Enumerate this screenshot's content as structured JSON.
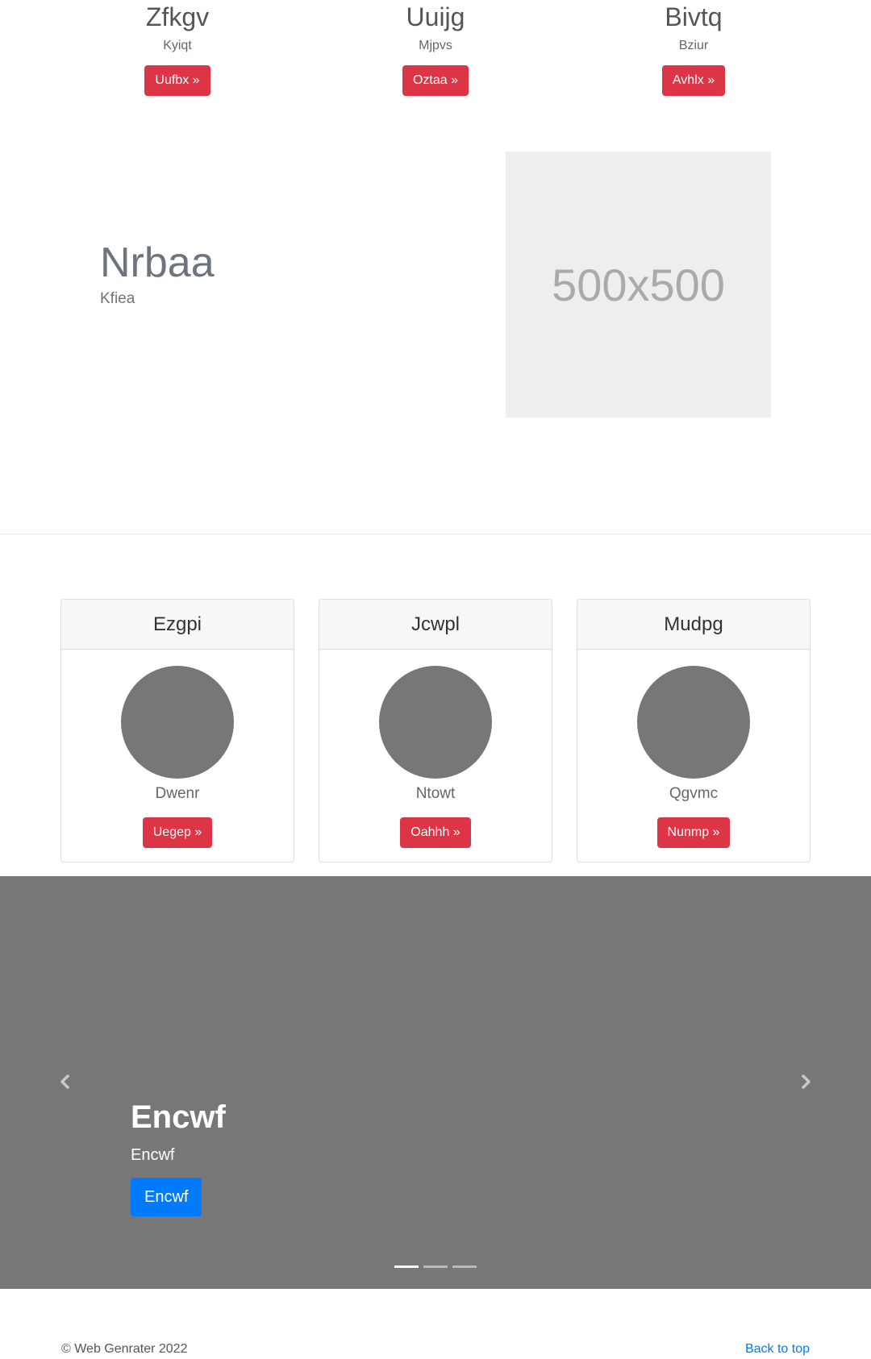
{
  "features": [
    {
      "title": "Zfkgv",
      "text": "Kyiqt",
      "button": "Uufbx »"
    },
    {
      "title": "Uuijg",
      "text": "Mjpvs",
      "button": "Oztaa »"
    },
    {
      "title": "Bivtq",
      "text": "Bziur",
      "button": "Avhlx »"
    }
  ],
  "featurette": {
    "heading": "Nrbaa",
    "lead": "Kfiea",
    "image_label": "500x500"
  },
  "cards": [
    {
      "header": "Ezgpi",
      "text": "Dwenr",
      "button": "Uegep »"
    },
    {
      "header": "Jcwpl",
      "text": "Ntowt",
      "button": "Oahhh »"
    },
    {
      "header": "Mudpg",
      "text": "Qgvmc",
      "button": "Nunmp »"
    }
  ],
  "carousel": {
    "heading": "Encwf",
    "text": "Encwf",
    "button": "Encwf",
    "slide_count": 3,
    "active_slide": 1
  },
  "footer": {
    "copyright": "© Web Genrater 2022",
    "back_to_top": "Back to top"
  },
  "colors": {
    "danger": "#dc3545",
    "primary": "#007bff",
    "carousel_bg": "#777777",
    "placeholder_bg": "#eeeeee"
  }
}
